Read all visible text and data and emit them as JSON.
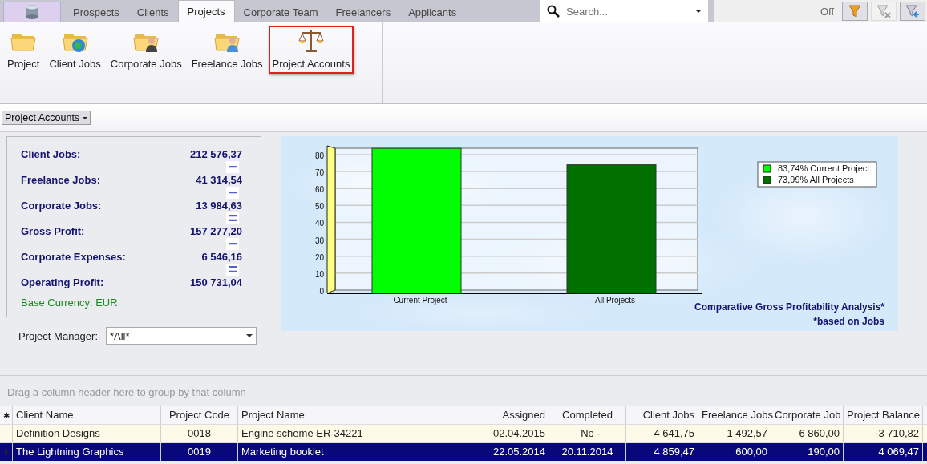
{
  "tabs": [
    {
      "label": "Prospects",
      "selected": false
    },
    {
      "label": "Clients",
      "selected": false
    },
    {
      "label": "Projects",
      "selected": true
    },
    {
      "label": "Corporate Team",
      "selected": false
    },
    {
      "label": "Freelancers",
      "selected": false
    },
    {
      "label": "Applicants",
      "selected": false
    }
  ],
  "search": {
    "placeholder": "Search..."
  },
  "filter": {
    "status": "Off"
  },
  "ribbon": [
    {
      "label": "Project",
      "kind": "folder",
      "selected": false
    },
    {
      "label": "Client Jobs",
      "kind": "globe",
      "selected": false
    },
    {
      "label": "Corporate Jobs",
      "kind": "person",
      "selected": false
    },
    {
      "label": "Freelance Jobs",
      "kind": "person",
      "selected": false
    },
    {
      "label": "Project Accounts",
      "kind": "scales",
      "selected": true
    }
  ],
  "view_selector": {
    "label": "Project Accounts"
  },
  "summary": {
    "rows": [
      {
        "label": "Client Jobs:",
        "value": "212 576,37",
        "operator": "−"
      },
      {
        "label": "Freelance Jobs:",
        "value": "41 314,54",
        "operator": "−"
      },
      {
        "label": "Corporate Jobs:",
        "value": "13 984,63",
        "operator": "="
      },
      {
        "label": "Gross Profit:",
        "value": "157 277,20",
        "operator": "−"
      },
      {
        "label": "Corporate Expenses:",
        "value": "6 546,16",
        "operator": "="
      },
      {
        "label": "Operating Profit:",
        "value": "150 731,04"
      }
    ],
    "currency": "Base Currency: EUR"
  },
  "chart": {
    "legend": [
      "83,74%",
      "73,99%"
    ],
    "title": "Comparative Gross Profitability Analysis*",
    "footnote": "*based on Jobs",
    "chart_data": {
      "type": "bar",
      "categories": [
        "Current Project",
        "All Projects"
      ],
      "series": [
        {
          "name": "Current Project",
          "color": "#00ff00",
          "values": [
            83.7,
            null
          ]
        },
        {
          "name": "All Projects",
          "color": "#007000",
          "values": [
            null,
            74.0
          ]
        }
      ],
      "ylim": [
        0,
        84
      ],
      "yticks": [
        0,
        10,
        20,
        30,
        40,
        50,
        60,
        70,
        80
      ],
      "grid": true
    }
  },
  "project_manager": {
    "label": "Project Manager:",
    "value": "*All*"
  },
  "grid": {
    "new_row_marker": "✱",
    "group_hint": "Drag a column header here to group by that column",
    "columns": [
      "Client Name",
      "Project Code",
      "Project Name",
      "Assigned",
      "Completed",
      "Client Jobs",
      "Freelance Jobs",
      "Corporate Job",
      "Project Balance"
    ],
    "rows": [
      {
        "cells": [
          "Definition Designs",
          "0018",
          "Engine scheme ER-34221",
          "02.04.2015",
          "- No -",
          "4 641,75",
          "1 492,57",
          "6 860,00",
          "-3 710,82"
        ],
        "selected": false
      },
      {
        "cells": [
          "The Lightning Graphics",
          "0019",
          "Marketing booklet",
          "22.05.2014",
          "20.11.2014",
          "4 859,47",
          "600,00",
          "190,00",
          "4 069,47"
        ],
        "selected": true
      }
    ]
  }
}
